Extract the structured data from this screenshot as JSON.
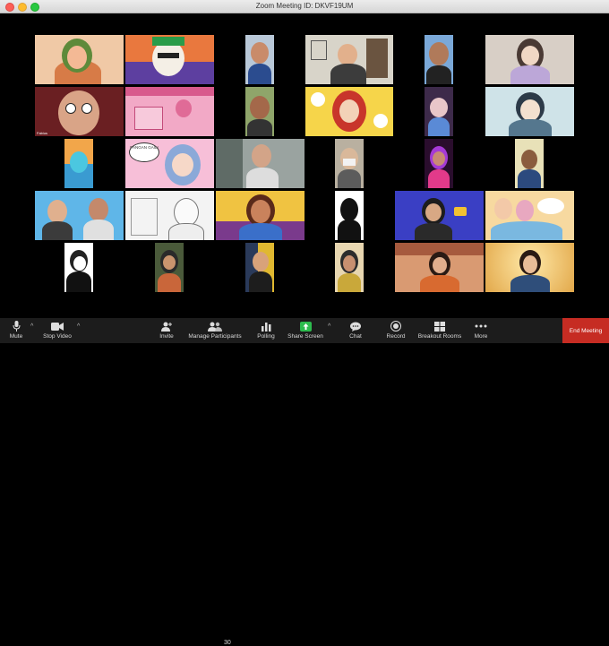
{
  "window": {
    "title": "Zoom Meeting ID: DKVF19UM"
  },
  "toolbar": {
    "mute": "Mute",
    "stop_video": "Stop Video",
    "invite": "Invite",
    "manage_participants": "Manage Participants",
    "participants_count": "30",
    "polling": "Polling",
    "share_screen": "Share Screen",
    "chat": "Chat",
    "record": "Record",
    "breakout_rooms": "Breakout Rooms",
    "more": "More",
    "end_meeting": "End Meeting"
  },
  "captions": {
    "fabius": "Fabius",
    "speech_bubble": "PANGAN GAIL!"
  },
  "colors": {
    "toolbar_bg": "#1c1c1c",
    "end_meeting": "#c62c23",
    "share_green": "#2dbb4e"
  }
}
